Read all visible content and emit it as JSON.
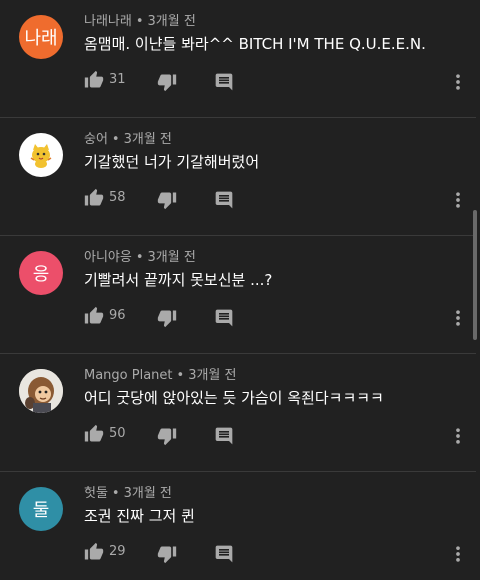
{
  "comments": [
    {
      "author": "나래나래",
      "time": "3개월 전",
      "text": "옴맴매. 이냔들 봐라^^ BITCH I'M THE Q.U.E.E.N.",
      "likes": "31",
      "avatar": {
        "type": "initial",
        "label": "나래",
        "color": "#ef6c2e"
      }
    },
    {
      "author": "숭어",
      "time": "3개월 전",
      "text": "기갈했던 너가 기갈해버렸어",
      "likes": "58",
      "avatar": {
        "type": "image",
        "icon": "yellow-cat-sticker-icon",
        "color": "#ffffff"
      }
    },
    {
      "author": "아니야응",
      "time": "3개월 전",
      "text": "기빨려서 끝까지 못보신분 ...?",
      "likes": "96",
      "avatar": {
        "type": "initial",
        "label": "응",
        "color": "#ec4f6a"
      }
    },
    {
      "author": "Mango Planet",
      "time": "3개월 전",
      "text": "어디 굿당에 앉아있는 듯 가슴이 옥죈다ㅋㅋㅋㅋ",
      "likes": "50",
      "avatar": {
        "type": "image",
        "icon": "cartoon-character-avatar-icon",
        "color": "#e9e6e0"
      }
    },
    {
      "author": "헛둘",
      "time": "3개월 전",
      "text": "조권 진짜 그저 퀸",
      "likes": "29",
      "avatar": {
        "type": "initial",
        "label": "둘",
        "color": "#2f8fa6"
      }
    }
  ]
}
